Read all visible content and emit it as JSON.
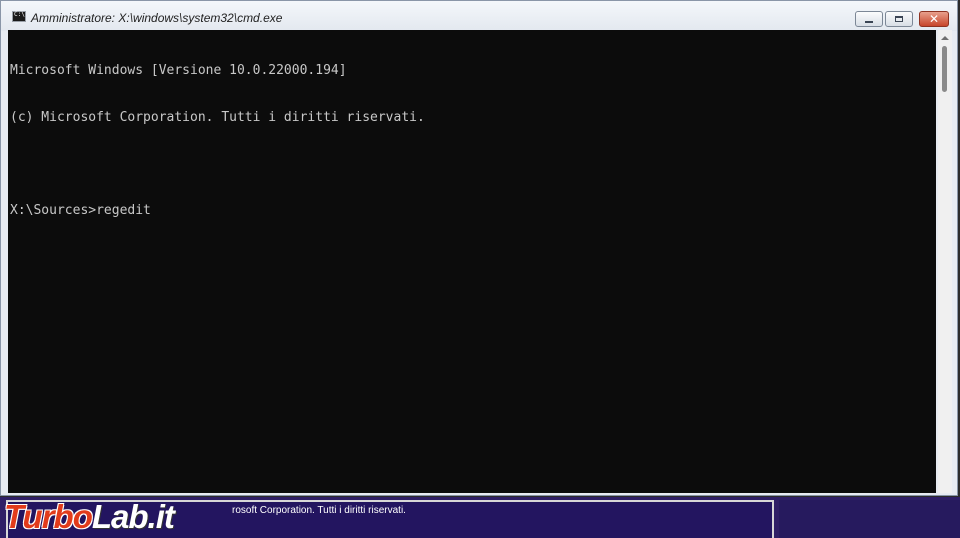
{
  "window": {
    "title": "Amministratore: X:\\windows\\system32\\cmd.exe",
    "icon": "cmd-icon",
    "buttons": {
      "minimize": "minimize-icon",
      "maximize": "maximize-icon",
      "close": "close-icon"
    }
  },
  "console": {
    "background": "#0c0c0c",
    "foreground": "#c8c8c8",
    "lines": [
      "Microsoft Windows [Versione 10.0.22000.194]",
      "(c) Microsoft Corporation. Tutti i diritti riservati.",
      "",
      "X:\\Sources>regedit"
    ]
  },
  "background_window": {
    "text": "rosoft Corporation. Tutti i diritti riservati."
  },
  "watermark": {
    "part1": "Turbo",
    "part2": "Lab.it",
    "colors": {
      "part1": "#e23b1b",
      "part2": "#ffffff"
    }
  }
}
